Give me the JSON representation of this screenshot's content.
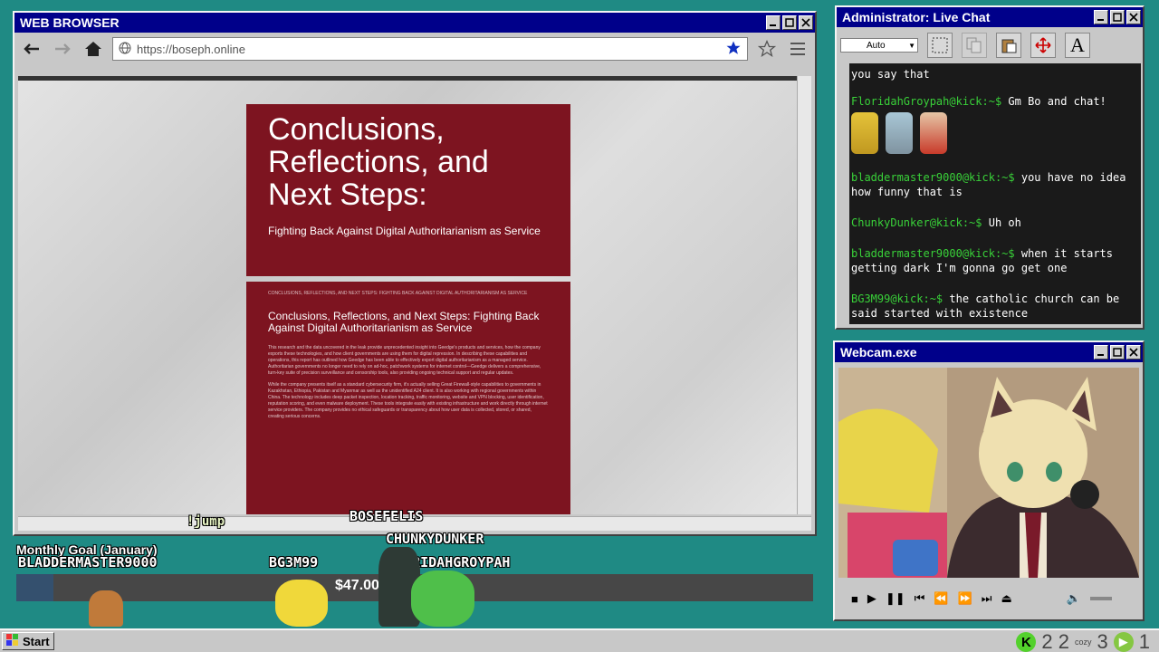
{
  "browser": {
    "title": "WEB BROWSER",
    "url": "https://boseph.online",
    "doc": {
      "cover_title": "Conclusions, Reflections, and Next Steps:",
      "cover_subtitle": "Fighting Back Against Digital Authoritarianism as Service",
      "page_header": "CONCLUSIONS, REFLECTIONS, AND NEXT STEPS: FIGHTING BACK AGAINST DIGITAL AUTHORITARIANISM AS SERVICE",
      "page_heading": "Conclusions, Reflections, and Next Steps: Fighting Back Against Digital Authoritarianism as Service",
      "para1": "This research and the data uncovered in the leak provide unprecedented insight into Geedge's products and services, how the company exports these technologies, and how client governments are using them for digital repression. In describing these capabilities and operations, this report has outlined how Geedge has been able to effectively export digital authoritarianism as a managed service. Authoritarian governments no longer need to rely on ad-hoc, patchwork systems for internet control—Geedge delivers a comprehensive, turn-key suite of precision surveillance and censorship tools, also providing ongoing technical support and regular updates.",
      "para2": "While the company presents itself as a standard cybersecurity firm, it's actually selling Great Firewall-style capabilities to governments in Kazakhstan, Ethiopia, Pakistan and Myanmar as well as the unidentified A24 client. It is also working with regional governments within China. The technology includes deep packet inspection, location tracking, traffic monitoring, website and VPN blocking, user identification, reputation scoring, and even malware deployment. These tools integrate easily with existing infrastructure and work directly through internet service providers. The company provides no ethical safeguards or transparency about how user data is collected, stored, or shared, creating serious concerns."
    }
  },
  "chat": {
    "title": "Administrator: Live Chat",
    "zoom": "Auto",
    "partial": "you say that",
    "messages": [
      {
        "user": "FloridahGroypah@kick:~$",
        "text": "Gm Bo and chat!"
      },
      {
        "user": "bladdermaster9000@kick:~$",
        "text": "you have no idea how funny that is"
      },
      {
        "user": "ChunkyDunker@kick:~$",
        "text": "Uh oh"
      },
      {
        "user": "bladdermaster9000@kick:~$",
        "text": "when it starts getting dark I'm gonna go get one"
      },
      {
        "user": "BG3M99@kick:~$",
        "text": "the catholic church can be said started with existence"
      }
    ]
  },
  "webcam": {
    "title": "Webcam.exe"
  },
  "overlay": {
    "jump": "!jump",
    "bosefelis": "BOSEFELIS",
    "chunky": "CHUNKYDUNKER",
    "goal_label": "Monthly Goal (January)",
    "bladder": "BLADDERMASTER9000",
    "bg3m99": "BG3M99",
    "floridah": "FLORIDAHGROYPAH",
    "goal_text": "$47.00/$1,000 (5%)",
    "goal_fraction": 0.047
  },
  "taskbar": {
    "start": "Start",
    "tray1": "2 2",
    "tray2": "3",
    "tray3": "1",
    "cozy": "cozy"
  },
  "colors": {
    "desktop": "#1f8a84",
    "titlebar": "#00008a",
    "doc": "#7d1420",
    "chat_user": "#39d139"
  }
}
